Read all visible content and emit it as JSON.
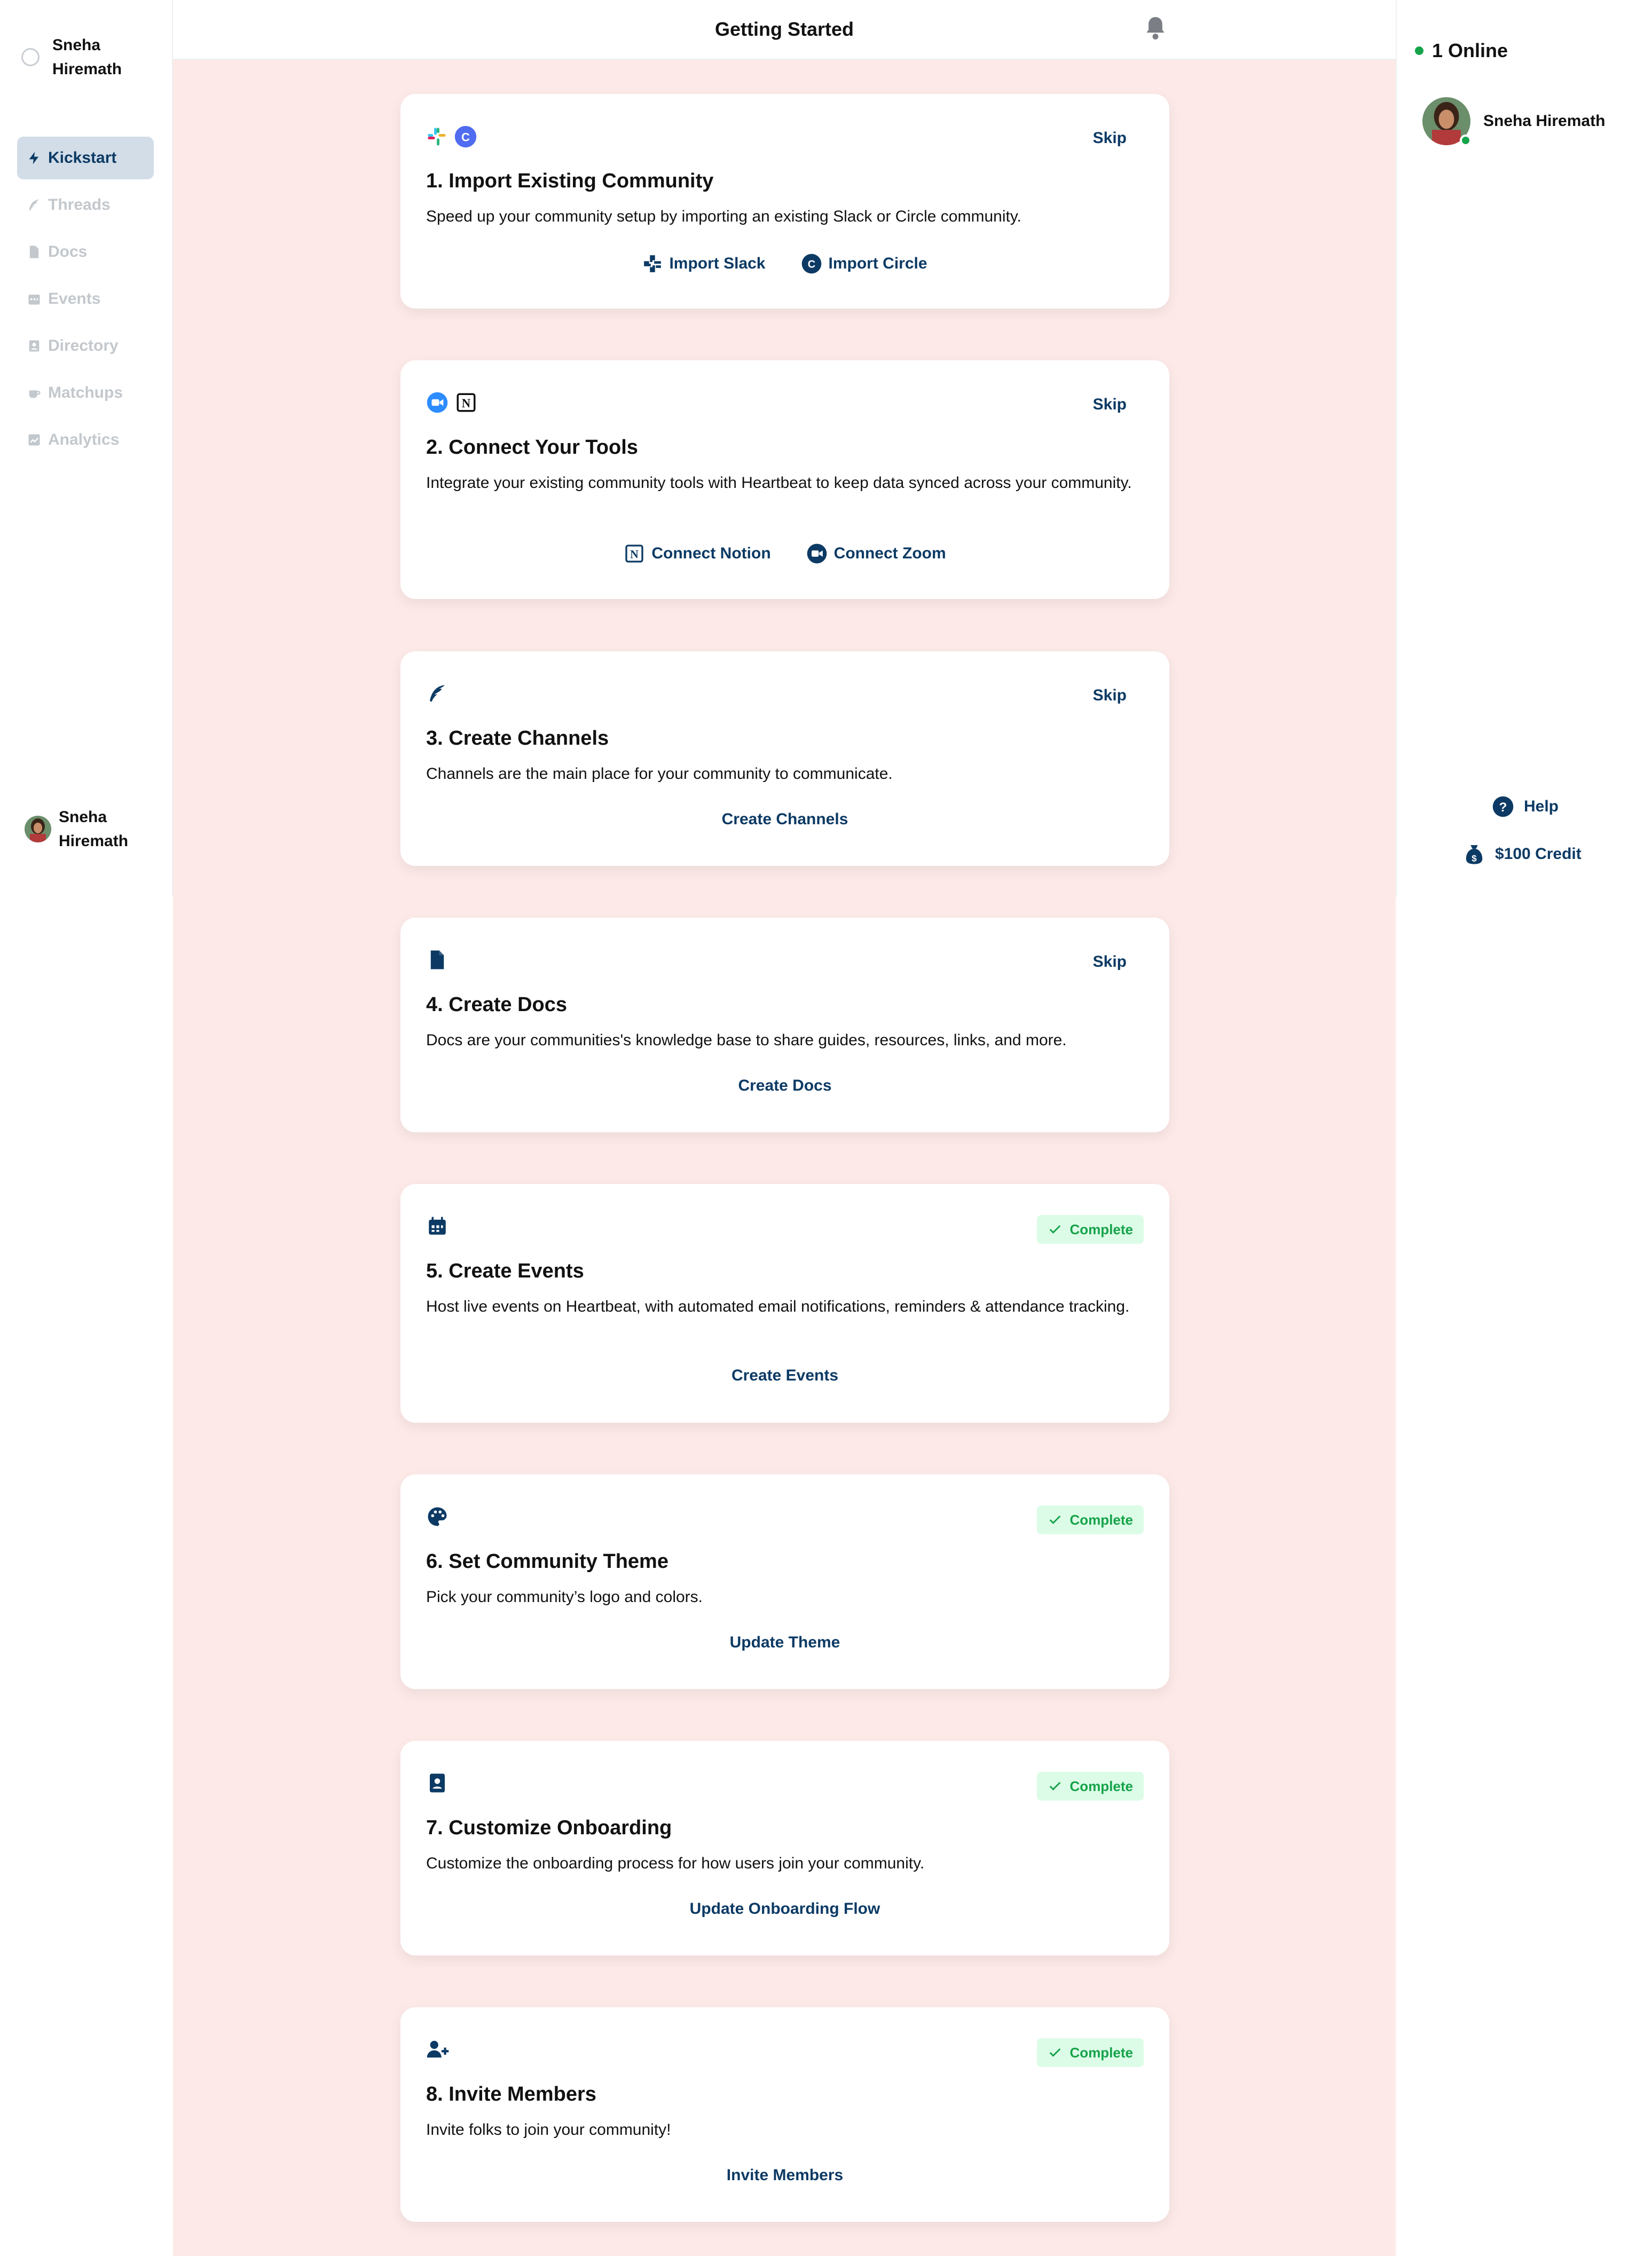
{
  "header": {
    "title": "Getting Started"
  },
  "sidebar": {
    "profile_name": "Sneha Hiremath",
    "items": [
      {
        "label": "Kickstart",
        "icon": "bolt-icon",
        "active": true
      },
      {
        "label": "Threads",
        "icon": "feather-icon",
        "active": false
      },
      {
        "label": "Docs",
        "icon": "file-icon",
        "active": false
      },
      {
        "label": "Events",
        "icon": "calendar-icon",
        "active": false
      },
      {
        "label": "Directory",
        "icon": "contact-icon",
        "active": false
      },
      {
        "label": "Matchups",
        "icon": "coffee-icon",
        "active": false
      },
      {
        "label": "Analytics",
        "icon": "chart-icon",
        "active": false
      }
    ],
    "bottom_name": "Sneha Hiremath"
  },
  "right": {
    "online_label": "1 Online",
    "user_name": "Sneha Hiremath",
    "help_label": "Help",
    "credit_label": "$100 Credit"
  },
  "cards": [
    {
      "title": "1. Import Existing Community",
      "desc": "Speed up your community setup by importing an existing Slack or Circle community.",
      "status": "Skip",
      "actions": [
        "Import Slack",
        "Import Circle"
      ]
    },
    {
      "title": "2. Connect Your Tools",
      "desc": "Integrate your existing community tools with Heartbeat to keep data synced across your community.",
      "status": "Skip",
      "actions": [
        "Connect Notion",
        "Connect Zoom"
      ]
    },
    {
      "title": "3. Create Channels",
      "desc": "Channels are the main place for your community to communicate.",
      "status": "Skip",
      "actions": [
        "Create Channels"
      ]
    },
    {
      "title": "4. Create Docs",
      "desc": "Docs are your communities's knowledge base to share guides, resources, links, and more.",
      "status": "Skip",
      "actions": [
        "Create Docs"
      ]
    },
    {
      "title": "5. Create Events",
      "desc": "Host live events on Heartbeat, with automated email notifications, reminders & attendance tracking.",
      "status": "Complete",
      "actions": [
        "Create Events"
      ]
    },
    {
      "title": "6. Set Community Theme",
      "desc": "Pick your community’s logo and colors.",
      "status": "Complete",
      "actions": [
        "Update Theme"
      ]
    },
    {
      "title": "7. Customize Onboarding",
      "desc": "Customize the onboarding process for how users join your community.",
      "status": "Complete",
      "actions": [
        "Update Onboarding Flow"
      ]
    },
    {
      "title": "8. Invite Members",
      "desc": "Invite folks to join your community!",
      "status": "Complete",
      "actions": [
        "Invite Members"
      ]
    }
  ],
  "colors": {
    "accent": "#0c3a64",
    "page_bg": "#fdeae8",
    "complete_green": "#16a34a",
    "complete_bg": "#dcfce7"
  }
}
